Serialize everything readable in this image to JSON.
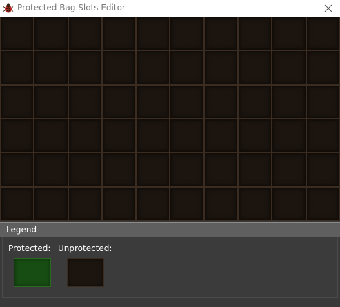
{
  "window": {
    "title": "Protected Bag Slots Editor",
    "close_icon": "close-icon",
    "app_icon": "app-bug-icon"
  },
  "grid": {
    "columns": 10,
    "rows": 6,
    "slot_color": "#1b140f",
    "slot_border_color": "#3a2c20"
  },
  "legend": {
    "title": "Legend",
    "protected_label": "Protected:",
    "unprotected_label": "Unprotected:",
    "protected_color": "#174d13",
    "unprotected_color": "#1b140f"
  }
}
